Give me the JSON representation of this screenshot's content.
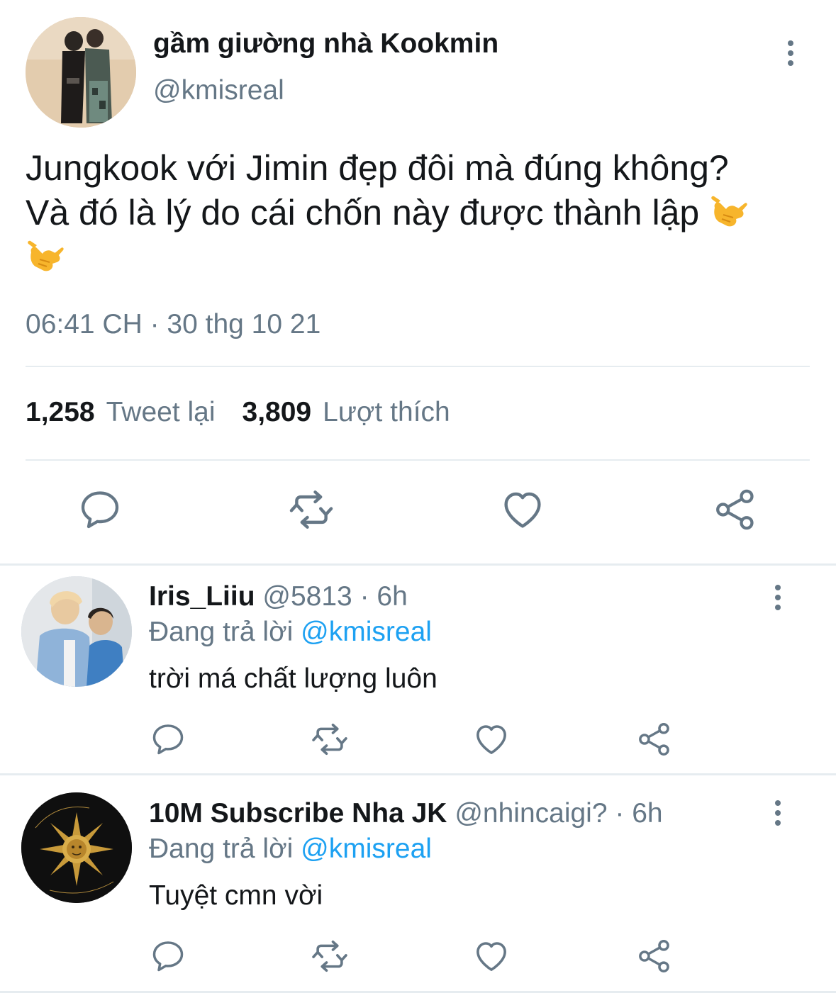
{
  "main_tweet": {
    "display_name": "gầm giường nhà Kookmin",
    "handle": "@kmisreal",
    "text_line1": "Jungkook với Jimin đẹp đôi mà đúng không?",
    "text_line2": "Và đó là lý do cái chốn này được thành lập",
    "timestamp": "06:41 CH · 30 thg 10 21",
    "retweet_count": "1,258",
    "retweet_label": "Tweet lại",
    "like_count": "3,809",
    "like_label": "Lượt thích",
    "emoji": "call-me-hand-emoji"
  },
  "replies": [
    {
      "display_name": "Iris_Liiu",
      "handle": "@5813 · 6h",
      "replying_prefix": "Đang trả lời ",
      "replying_to": "@kmisreal",
      "text": "trời má chất lượng luôn"
    },
    {
      "display_name": "10M Subscribe Nha JK",
      "handle": "@nhincaigi? · 6h",
      "replying_prefix": "Đang trả lời ",
      "replying_to": "@kmisreal",
      "text": "Tuyệt cmn vời"
    }
  ],
  "icons": {
    "reply": "reply-icon",
    "retweet": "retweet-icon",
    "like": "heart-icon",
    "share": "share-icon",
    "more": "more-vertical-icon"
  },
  "colors": {
    "text_primary": "#14171a",
    "text_secondary": "#657786",
    "link": "#1da1f2",
    "divider": "#e6ecf0"
  }
}
